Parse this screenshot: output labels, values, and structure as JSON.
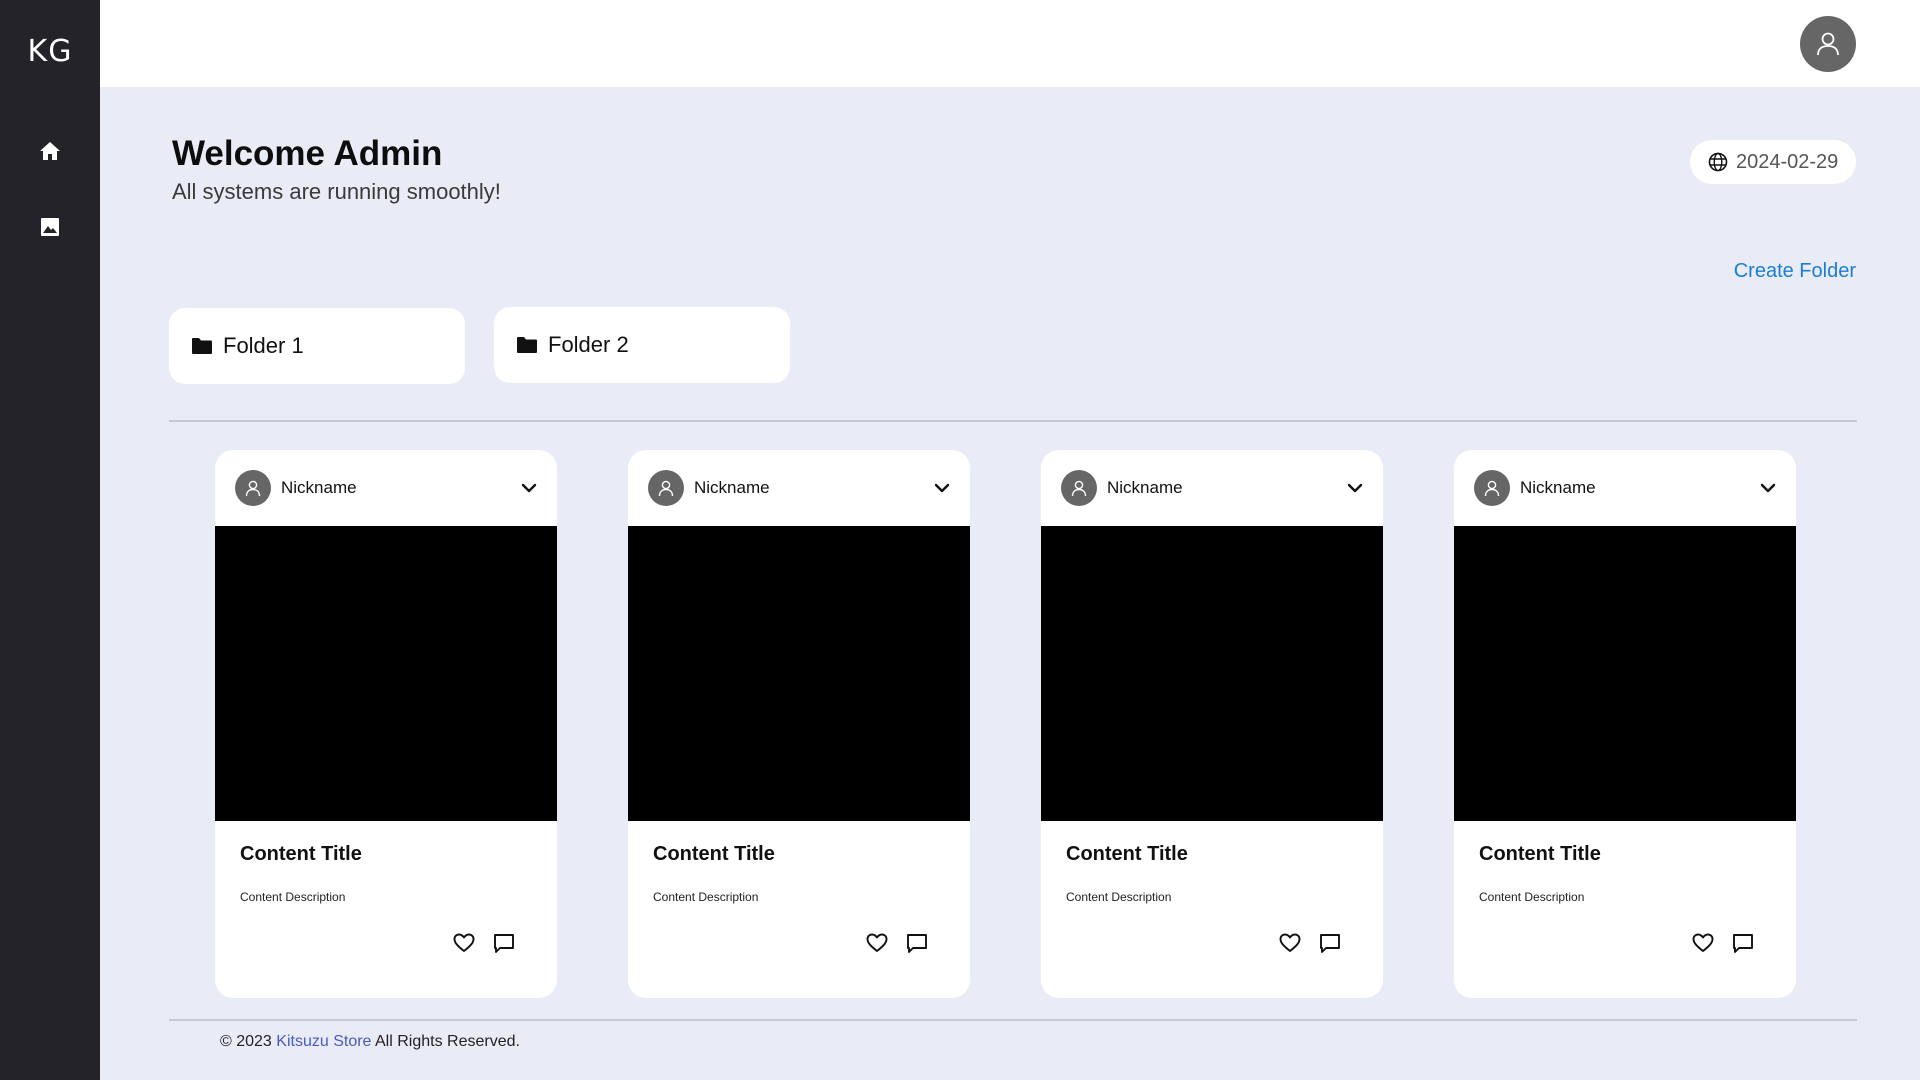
{
  "sidebar": {
    "logo": "KG",
    "items": [
      {
        "icon": "home-icon"
      },
      {
        "icon": "image-icon"
      }
    ]
  },
  "header": {
    "avatar_icon": "user-icon"
  },
  "welcome": {
    "title": "Welcome Admin",
    "subtitle": "All systems are running smoothly!"
  },
  "date": {
    "icon": "globe-icon",
    "value": "2024-02-29"
  },
  "actions": {
    "create_folder": "Create Folder"
  },
  "folders": [
    {
      "label": "Folder 1",
      "icon": "folder-icon"
    },
    {
      "label": "Folder 2",
      "icon": "folder-icon"
    }
  ],
  "cards": [
    {
      "nickname": "Nickname",
      "title": "Content Title",
      "description": "Content Description"
    },
    {
      "nickname": "Nickname",
      "title": "Content Title",
      "description": "Content Description"
    },
    {
      "nickname": "Nickname",
      "title": "Content Title",
      "description": "Content Description"
    },
    {
      "nickname": "Nickname",
      "title": "Content Title",
      "description": "Content Description"
    }
  ],
  "footer": {
    "prefix": "© 2023",
    "link": "Kitsuzu Store",
    "suffix": "All Rights Reserved."
  },
  "colors": {
    "sidebar": "#232329",
    "background": "#e9ebf6",
    "accent": "#1a7fd1",
    "footer_link": "#4a5bbd"
  }
}
